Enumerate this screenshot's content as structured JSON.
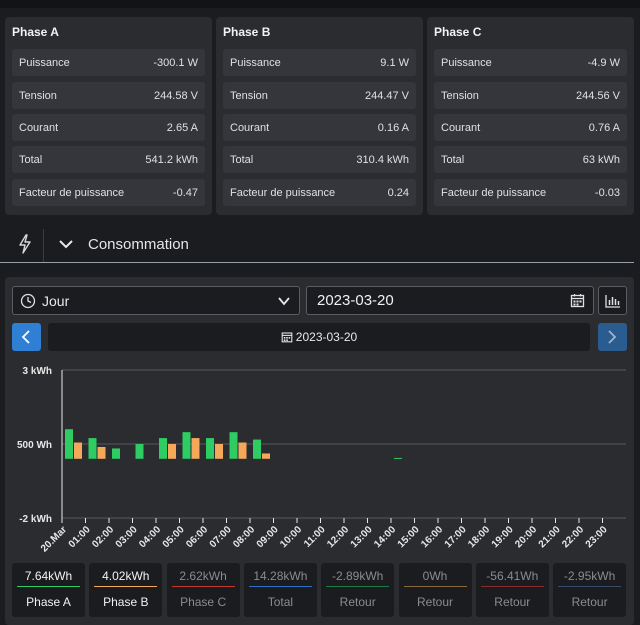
{
  "phases": [
    {
      "title": "Phase A",
      "rows": [
        {
          "label": "Puissance",
          "value": "-300.1 W"
        },
        {
          "label": "Tension",
          "value": "244.58 V"
        },
        {
          "label": "Courant",
          "value": "2.65 A"
        },
        {
          "label": "Total",
          "value": "541.2 kWh"
        },
        {
          "label": "Facteur de puissance",
          "value": "-0.47"
        }
      ]
    },
    {
      "title": "Phase B",
      "rows": [
        {
          "label": "Puissance",
          "value": "9.1 W"
        },
        {
          "label": "Tension",
          "value": "244.47 V"
        },
        {
          "label": "Courant",
          "value": "0.16 A"
        },
        {
          "label": "Total",
          "value": "310.4 kWh"
        },
        {
          "label": "Facteur de puissance",
          "value": "0.24"
        }
      ]
    },
    {
      "title": "Phase C",
      "rows": [
        {
          "label": "Puissance",
          "value": "-4.9 W"
        },
        {
          "label": "Tension",
          "value": "244.56 V"
        },
        {
          "label": "Courant",
          "value": "0.76 A"
        },
        {
          "label": "Total",
          "value": "63 kWh"
        },
        {
          "label": "Facteur de puissance",
          "value": "-0.03"
        }
      ]
    }
  ],
  "section": {
    "title": "Consommation",
    "icon": "lightning-icon"
  },
  "controls": {
    "period": "Jour",
    "date": "2023-03-20",
    "nav_date": "2023-03-20"
  },
  "chart_data": {
    "type": "bar",
    "ytick_labels": [
      "3 kWh",
      "500 Wh",
      "-2 kWh"
    ],
    "ylim": [
      -2000,
      3000
    ],
    "categories": [
      "20.Mar",
      "01:00",
      "02:00",
      "03:00",
      "04:00",
      "05:00",
      "06:00",
      "07:00",
      "08:00",
      "09:00",
      "10:00",
      "11:00",
      "12:00",
      "13:00",
      "14:00",
      "15:00",
      "16:00",
      "17:00",
      "18:00",
      "19:00",
      "20:00",
      "21:00",
      "22:00",
      "23:00"
    ],
    "series": [
      {
        "name": "Phase A",
        "color": "#2ecc63",
        "values": [
          1000,
          700,
          350,
          500,
          700,
          900,
          700,
          900,
          650,
          0,
          0,
          0,
          0,
          0,
          30,
          0,
          0,
          0,
          0,
          0,
          0,
          0,
          0,
          0
        ]
      },
      {
        "name": "Phase B",
        "color": "#f5a85a",
        "values": [
          550,
          400,
          0,
          0,
          500,
          700,
          500,
          550,
          180,
          0,
          0,
          0,
          0,
          0,
          0,
          0,
          0,
          0,
          0,
          0,
          0,
          0,
          0,
          0
        ]
      }
    ]
  },
  "summary": [
    {
      "value": "7.64kWh",
      "label": "Phase A",
      "color": "#2ecc63",
      "active": true
    },
    {
      "value": "4.02kWh",
      "label": "Phase B",
      "color": "#f5a85a",
      "active": true
    },
    {
      "value": "2.62kWh",
      "label": "Phase C",
      "color": "#c0392b",
      "active": false
    },
    {
      "value": "14.28kWh",
      "label": "Total",
      "color": "#2f6fc9",
      "active": false
    },
    {
      "value": "-2.89kWh",
      "label": "Retour",
      "color": "#1e7a44",
      "active": false
    },
    {
      "value": "0Wh",
      "label": "Retour",
      "color": "#8a6a3a",
      "active": false
    },
    {
      "value": "-56.41Wh",
      "label": "Retour",
      "color": "#8a2c2c",
      "active": false
    },
    {
      "value": "-2.95kWh",
      "label": "Retour",
      "color": "#3a4a6a",
      "active": false
    }
  ]
}
